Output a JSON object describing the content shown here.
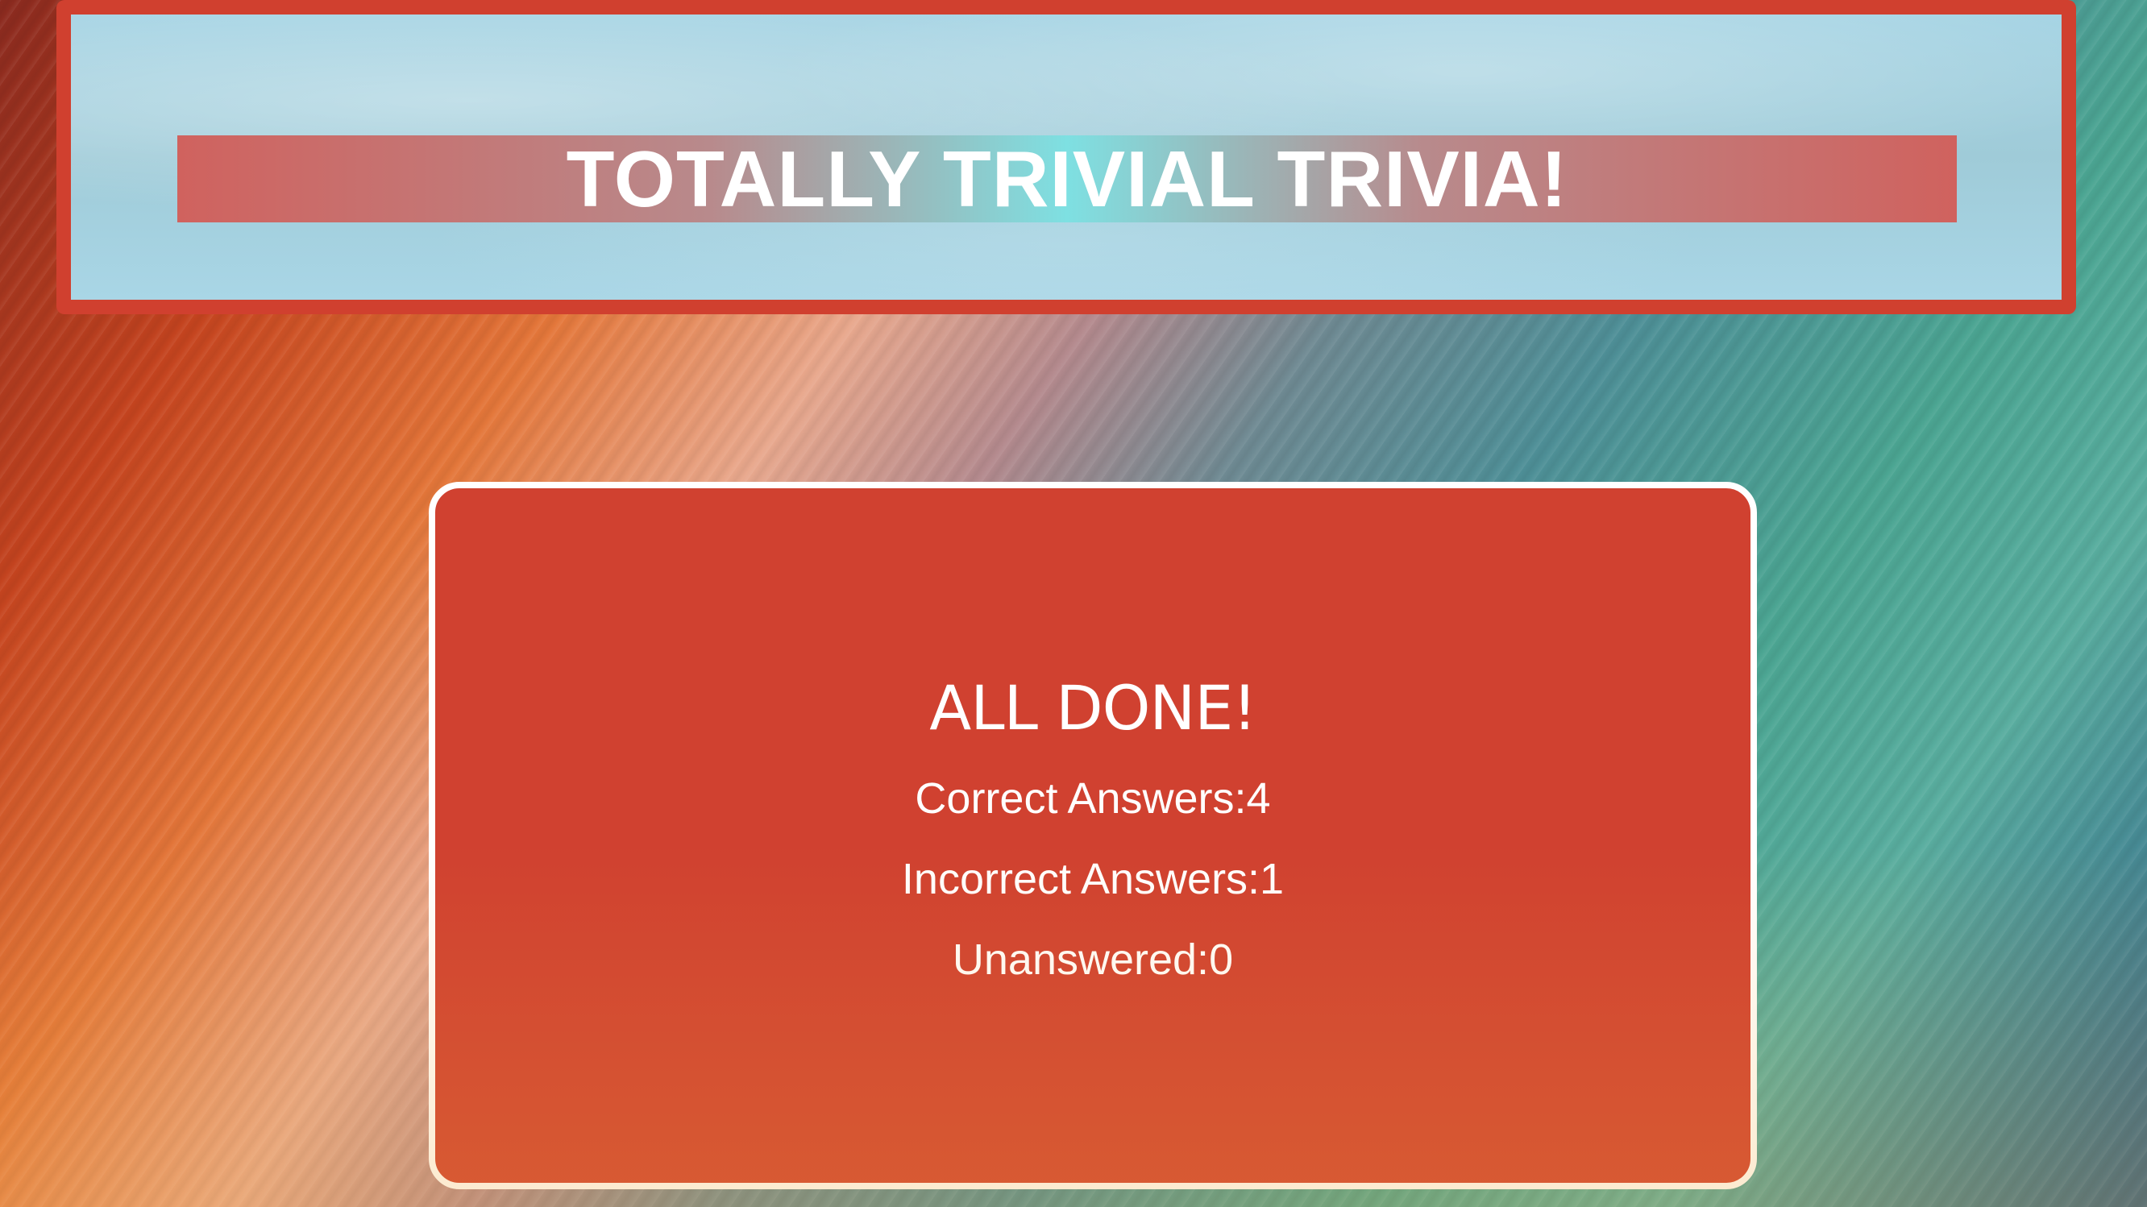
{
  "header": {
    "title": "TOTALLY TRIVIAL TRIVIA!"
  },
  "results": {
    "heading": "ALL DONE!",
    "correct": "Correct Answers:4",
    "incorrect": "Incorrect Answers:1",
    "unanswered": "Unanswered:0"
  },
  "colors": {
    "accent_red": "#d04130",
    "header_border": "#d0402f",
    "card_border": "#ffffff",
    "text": "#ffffff"
  }
}
